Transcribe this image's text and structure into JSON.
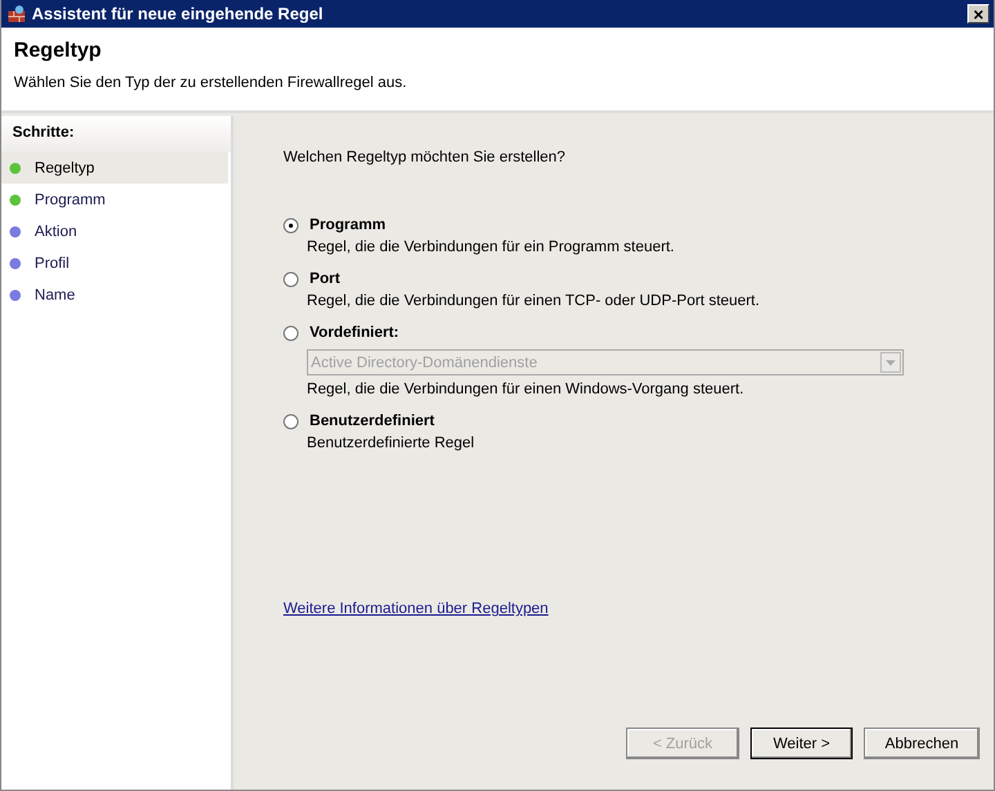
{
  "window": {
    "title": "Assistent für neue eingehende Regel",
    "close": "×"
  },
  "header": {
    "title": "Regeltyp",
    "subtitle": "Wählen Sie den Typ der zu erstellenden Firewallregel aus."
  },
  "sidebar": {
    "title": "Schritte:",
    "items": [
      {
        "label": "Regeltyp",
        "selected": true,
        "color": "#5cc43c"
      },
      {
        "label": "Programm",
        "selected": false,
        "color": "#5cc43c"
      },
      {
        "label": "Aktion",
        "selected": false,
        "color": "#7a7ae0"
      },
      {
        "label": "Profil",
        "selected": false,
        "color": "#7a7ae0"
      },
      {
        "label": "Name",
        "selected": false,
        "color": "#7a7ae0"
      }
    ]
  },
  "question": "Welchen Regeltyp möchten Sie erstellen?",
  "options": [
    {
      "label": "Programm",
      "description": "Regel, die die Verbindungen für ein Programm steuert.",
      "selected": true
    },
    {
      "label": "Port",
      "description": "Regel, die die Verbindungen für einen TCP- oder UDP-Port steuert.",
      "selected": false
    },
    {
      "label": "Vordefiniert:",
      "description": "Regel, die die Verbindungen für einen Windows-Vorgang steuert.",
      "selected": false,
      "dropdown": {
        "value": "Active Directory-Domänendienste",
        "disabled": true
      }
    },
    {
      "label": "Benutzerdefiniert",
      "description": "Benutzerdefinierte Regel",
      "selected": false
    }
  ],
  "info_link": "Weitere Informationen über Regeltypen",
  "buttons": [
    {
      "label": "< Zurück",
      "disabled": true,
      "default": false
    },
    {
      "label": "Weiter >",
      "disabled": false,
      "default": true
    },
    {
      "label": "Abbrechen",
      "disabled": false,
      "default": false
    }
  ]
}
